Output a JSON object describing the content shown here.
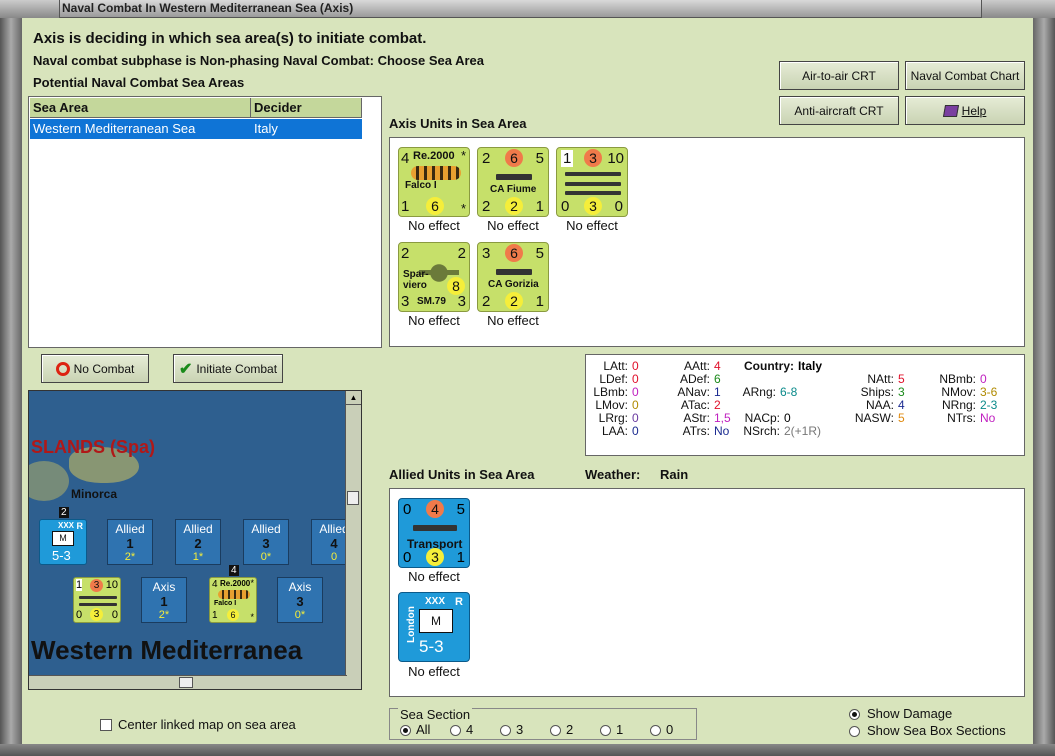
{
  "window": {
    "title": "Naval Combat In Western Mediterranean Sea (Axis)"
  },
  "header": {
    "line1": "Axis is deciding in which sea area(s) to initiate combat.",
    "line2": "Naval combat subphase is Non-phasing Naval Combat: Choose Sea Area",
    "line3": "Potential Naval Combat Sea Areas"
  },
  "toolbar": {
    "air_to_air": "Air-to-air CRT",
    "naval_chart": "Naval Combat Chart",
    "anti_aircraft": "Anti-aircraft CRT",
    "help": "Help"
  },
  "sea_table": {
    "columns": [
      "Sea Area",
      "Decider"
    ],
    "rows": [
      {
        "sea_area": "Western Mediterranean Sea",
        "decider": "Italy"
      }
    ]
  },
  "axis_units": {
    "label": "Axis Units in Sea Area",
    "units": [
      {
        "name": "Re.2000",
        "sub": "Falco I",
        "tl": "4",
        "tr": "*",
        "bl": "1",
        "bm": "6",
        "br": "*",
        "effect": "No effect"
      },
      {
        "name": "CA Fiume",
        "tl": "2",
        "tm": "6",
        "tr": "5",
        "bl": "2",
        "bm": "2",
        "br": "1",
        "effect": "No effect"
      },
      {
        "name": "",
        "tl": "1",
        "tm": "3",
        "tr": "10",
        "bl": "0",
        "bm": "3",
        "br": "0",
        "effect": "No effect"
      },
      {
        "name": "Spar-viero",
        "sub": "SM.79",
        "tl": "2",
        "tr": "2",
        "bl": "3",
        "bm": "8",
        "br": "3",
        "effect": "No effect"
      },
      {
        "name": "CA Gorizia",
        "tl": "3",
        "tm": "6",
        "tr": "5",
        "bl": "2",
        "bm": "2",
        "br": "1",
        "effect": "No effect"
      }
    ]
  },
  "actions": {
    "no_combat": "No Combat",
    "initiate_combat": "Initiate Combat"
  },
  "stats": {
    "country_label": "Country:",
    "country": "Italy",
    "rows": [
      {
        "k": "LAtt:",
        "v": "0"
      },
      {
        "k": "LDef:",
        "v": "0"
      },
      {
        "k": "LBmb:",
        "v": "0"
      },
      {
        "k": "LMov:",
        "v": "0"
      },
      {
        "k": "LRrg:",
        "v": "0"
      },
      {
        "k": "LAA:",
        "v": "0"
      },
      {
        "k": "AAtt:",
        "v": "4"
      },
      {
        "k": "ADef:",
        "v": "6"
      },
      {
        "k": "ANav:",
        "v": "1"
      },
      {
        "k": "ATac:",
        "v": "2"
      },
      {
        "k": "AStr:",
        "v": "1,5"
      },
      {
        "k": "ATrs:",
        "v": "No"
      },
      {
        "k": "ARng:",
        "v": "6-8"
      },
      {
        "k": "NACp:",
        "v": "0"
      },
      {
        "k": "NSrch:",
        "v": "2(+1R)"
      },
      {
        "k": "NAtt:",
        "v": "5"
      },
      {
        "k": "Ships:",
        "v": "3"
      },
      {
        "k": "NAA:",
        "v": "4"
      },
      {
        "k": "NASW:",
        "v": "5"
      },
      {
        "k": "NBmb:",
        "v": "0"
      },
      {
        "k": "NMov:",
        "v": "3-6"
      },
      {
        "k": "NRng:",
        "v": "2-3"
      },
      {
        "k": "NTrs:",
        "v": "No"
      }
    ]
  },
  "allied": {
    "label": "Allied Units in Sea Area",
    "weather_label": "Weather:",
    "weather": "Rain",
    "units": [
      {
        "name": "Transport",
        "tl": "0",
        "tm": "4",
        "tr": "5",
        "bl": "0",
        "bm": "3",
        "br": "1",
        "effect": "No effect"
      },
      {
        "name": "London",
        "tag": "XXX",
        "r": "R",
        "m": "M",
        "val": "5-3",
        "effect": "No effect"
      }
    ]
  },
  "map": {
    "region": "SLANDS (Spa)",
    "island": "Minorca",
    "sea": "Western Mediterranea",
    "allied_boxes": [
      {
        "a": "Allied",
        "b": "1",
        "c": "2*"
      },
      {
        "a": "Allied",
        "b": "2",
        "c": "1*"
      },
      {
        "a": "Allied",
        "b": "3",
        "c": "0*"
      },
      {
        "a": "Allied",
        "b": "4",
        "c": "0"
      }
    ],
    "axis_boxes": [
      {
        "a": "Axis",
        "b": "1",
        "c": "2*"
      },
      {
        "a": "Axis",
        "b": "3",
        "c": "0*"
      },
      {
        "a": "A",
        "b": "",
        "c": ""
      }
    ],
    "stack_counts": [
      "2",
      "4"
    ],
    "map_unit": {
      "tag": "XXX",
      "r": "R",
      "m": "M",
      "val": "5-3"
    },
    "map_ship": {
      "tl": "1",
      "tm": "3",
      "tr": "10",
      "bl": "0",
      "bm": "3",
      "br": "0"
    },
    "map_air": {
      "name": "Re.2000",
      "sub": "Falco I",
      "tl": "4",
      "tr": "*",
      "bl": "1",
      "bm": "6",
      "br": "*"
    }
  },
  "center_linked": "Center linked map on sea area",
  "sea_section": {
    "label": "Sea Section",
    "options": [
      "All",
      "4",
      "3",
      "2",
      "1",
      "0"
    ],
    "selected": "All"
  },
  "show_damage": "Show Damage",
  "show_sea_box": "Show Sea Box Sections"
}
